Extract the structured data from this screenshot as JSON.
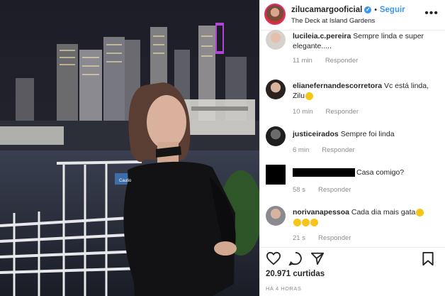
{
  "post": {
    "username": "zilucamargooficial",
    "verified": "✓",
    "separator": "•",
    "follow_label": "Seguir",
    "location": "The Deck at Island Gardens",
    "more_label": "•••",
    "photo_sign": "Cautio"
  },
  "comments": [
    {
      "user": "lucileia.c.pereira",
      "text": "Sempre linda e super elegante.....",
      "time": "11 min",
      "reply": "Responder"
    },
    {
      "user": "elianefernandescorretora",
      "text": "Vc está linda, Zilu",
      "time": "10 min",
      "reply": "Responder"
    },
    {
      "user": "justiceirados",
      "text": "Sempre foi linda",
      "time": "6 min",
      "reply": "Responder"
    },
    {
      "user": "",
      "text": "Casa comigo?",
      "time": "58 s",
      "reply": "Responder"
    },
    {
      "user": "norivanapessoa",
      "text": "Cada dia mais gata",
      "time": "21 s",
      "reply": "Responder"
    }
  ],
  "stats": {
    "likes": "20.971 curtidas",
    "time_ago": "HÁ 4 HORAS"
  },
  "icons": [
    "heart-icon",
    "comment-icon",
    "share-icon",
    "bookmark-icon",
    "verified-badge-icon",
    "more-options-icon"
  ],
  "colors": {
    "link": "#3897f0",
    "text": "#262626",
    "meta": "#8e8e8e",
    "verified": "#3897f0"
  }
}
